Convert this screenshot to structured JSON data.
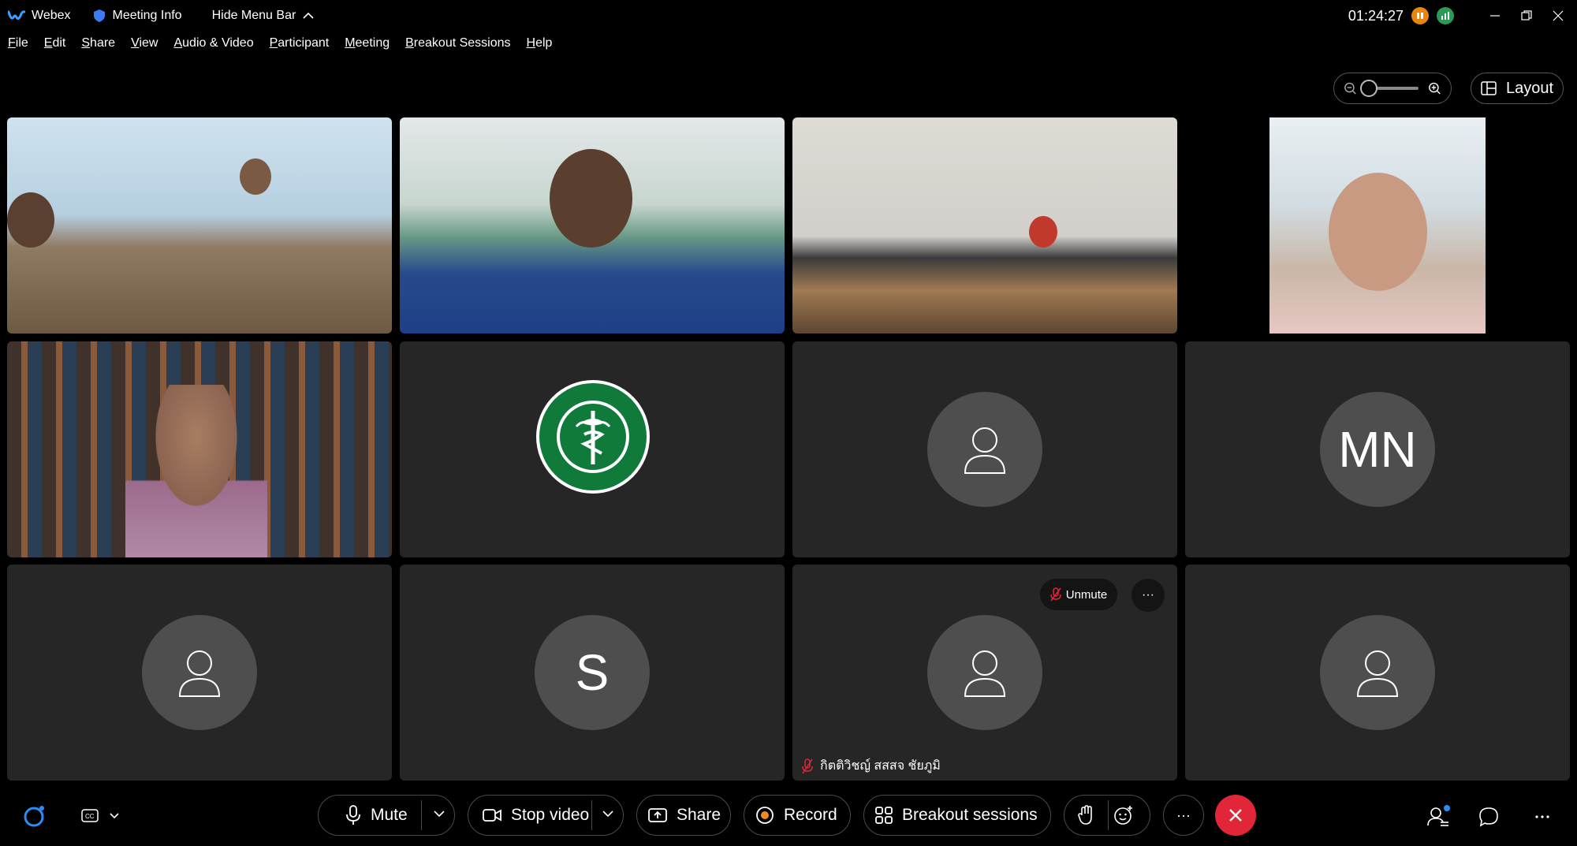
{
  "titlebar": {
    "app_name": "Webex",
    "meeting_info": "Meeting Info",
    "hide_menu_bar": "Hide Menu Bar",
    "clock": "01:24:27"
  },
  "menu": [
    "File",
    "Edit",
    "Share",
    "View",
    "Audio & Video",
    "Participant",
    "Meeting",
    "Breakout Sessions",
    "Help"
  ],
  "menu_underline": [
    "F",
    "E",
    "S",
    "V",
    "A",
    "P",
    "M",
    "B",
    "H"
  ],
  "menu_rest": [
    "ile",
    "dit",
    "hare",
    "iew",
    "udio & Video",
    "articipant",
    "eeting",
    "reakout Sessions",
    "elp"
  ],
  "view": {
    "layout_label": "Layout"
  },
  "tiles": {
    "r2c4_initials": "MN",
    "r3c2_initials": "S",
    "r3c3_name": "กิตติวิชญ์ สสสจ ชัยภูมิ",
    "unmute_label": "Unmute",
    "more_label": "···"
  },
  "toolbar": {
    "mute": "Mute",
    "stop_video": "Stop video",
    "share": "Share",
    "record": "Record",
    "breakout": "Breakout sessions",
    "more": "···"
  },
  "icons": {
    "title": [
      "webex-logo-icon",
      "shield-icon",
      "chevron-up-icon",
      "pause-icon",
      "stats-icon",
      "minimize-icon",
      "restore-icon",
      "close-icon"
    ],
    "toolbar": [
      "webex-assistant-icon",
      "captions-icon",
      "microphone-icon",
      "camera-icon",
      "share-icon",
      "record-icon",
      "breakout-icon",
      "raise-hand-icon",
      "reactions-icon",
      "leave-icon",
      "participants-icon",
      "chat-icon",
      "more-icon"
    ]
  },
  "colors": {
    "background": "#000000",
    "tile": "#262626",
    "avatar": "#4e4e4e",
    "leave": "#e2263a",
    "mute_slash": "#e2263a",
    "status_pause": "#e8850a",
    "status_stats": "#2a9b55",
    "notification_dot": "#2a8cf5"
  }
}
